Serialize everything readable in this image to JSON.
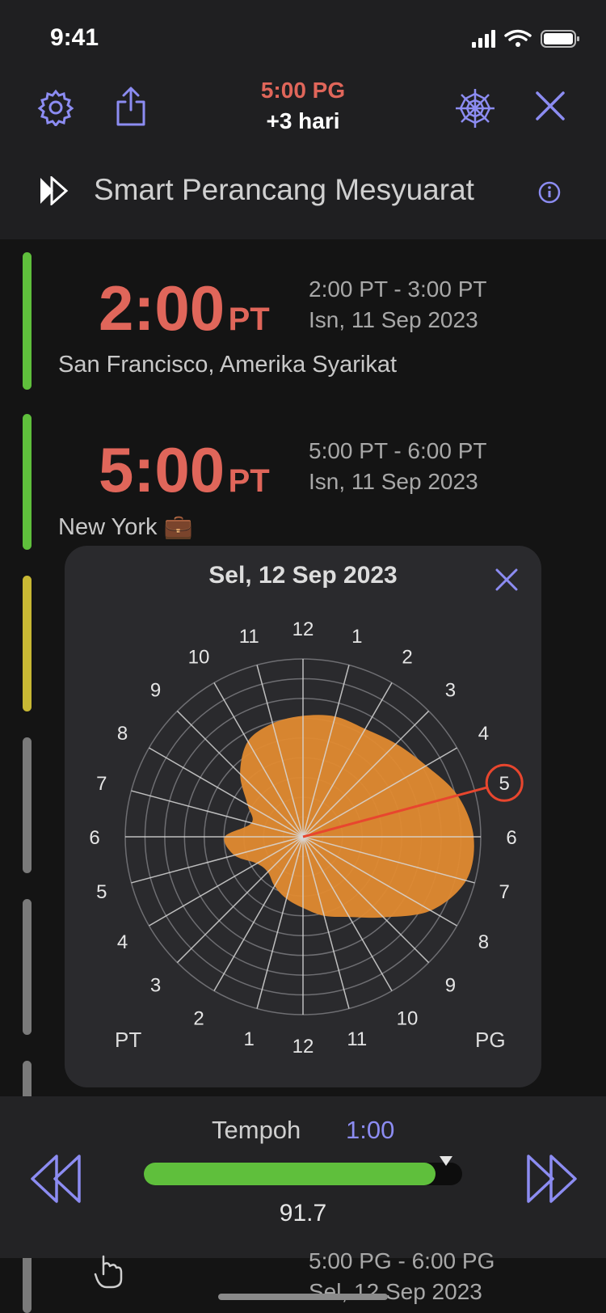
{
  "status": {
    "time": "9:41"
  },
  "header": {
    "time_label": "5:00 PG",
    "offset_label": "+3 hari",
    "title": "Smart Perancang Mesyuarat",
    "icons": [
      "gear-icon",
      "share-icon",
      "web-icon",
      "close-icon",
      "logo-icon",
      "info-icon"
    ]
  },
  "entries": [
    {
      "time": "2:00",
      "ampm": "PT",
      "range": "2:00 PT - 3:00 PT",
      "date": "Isn, 11 Sep 2023",
      "city": "San Francisco, Amerika Syarikat",
      "bar_color": "#5fbf3c"
    },
    {
      "time": "5:00",
      "ampm": "PT",
      "range": "5:00 PT - 6:00 PT",
      "date": "Isn, 11 Sep 2023",
      "city": "New York 💼",
      "bar_color": "#5fbf3c"
    }
  ],
  "bottom_entry": {
    "range": "5:00 PG - 6:00 PG",
    "date": "Sel, 12 Sep 2023"
  },
  "popup": {
    "title": "Sel, 12 Sep 2023",
    "am_label": "PT",
    "pm_label": "PG",
    "highlighted_hour": "5",
    "hour_labels": [
      "12",
      "1",
      "2",
      "3",
      "4",
      "5",
      "6",
      "7",
      "8",
      "9",
      "10",
      "11",
      "12",
      "1",
      "2",
      "3",
      "4",
      "5",
      "6",
      "7",
      "8",
      "9",
      "10",
      "11"
    ]
  },
  "footer": {
    "tempoh_label": "Tempoh",
    "duration": "1:00",
    "value": "91.7",
    "progress": 0.917
  },
  "colors": {
    "accent": "#8c8cf2",
    "time": "#e0665a",
    "good": "#5fbf3c",
    "ok": "#c8b834",
    "polar": "#e08a30"
  }
}
